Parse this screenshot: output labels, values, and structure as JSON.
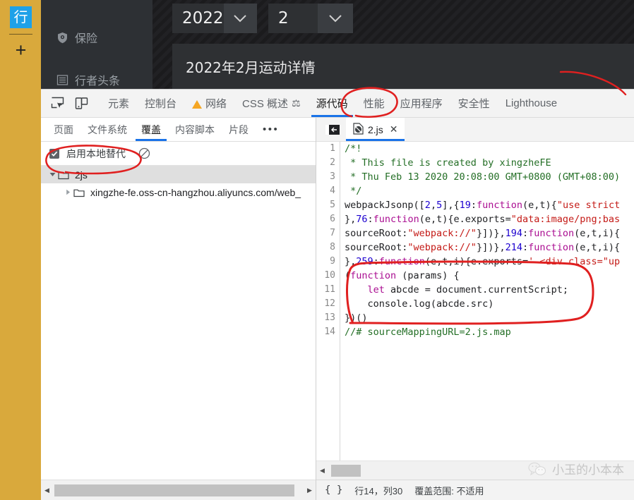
{
  "page": {
    "rail": {
      "logo_text": "行",
      "add_label": "+"
    },
    "sidebar": {
      "items": [
        {
          "label": "保险",
          "icon": "shield-icon"
        },
        {
          "label": "行者头条",
          "icon": "list-icon"
        }
      ]
    },
    "filters": {
      "year_value": "2022",
      "month_value": "2"
    },
    "content_title": "2022年2月运动详情"
  },
  "devtools": {
    "toolbar": {
      "inspect_icon": "inspect-element-icon",
      "device_icon": "device-toolbar-icon",
      "tabs": [
        {
          "label": "元素",
          "active": false,
          "warn": false
        },
        {
          "label": "控制台",
          "active": false,
          "warn": false
        },
        {
          "label": "网络",
          "active": false,
          "warn": true
        },
        {
          "label": "CSS 概述",
          "active": false,
          "warn": false,
          "flask": true
        },
        {
          "label": "源代码",
          "active": true,
          "warn": false
        },
        {
          "label": "性能",
          "active": false,
          "warn": false
        },
        {
          "label": "应用程序",
          "active": false,
          "warn": false
        },
        {
          "label": "安全性",
          "active": false,
          "warn": false
        },
        {
          "label": "Lighthouse",
          "active": false,
          "warn": false
        }
      ]
    },
    "navigator": {
      "tabs": [
        {
          "label": "页面",
          "active": false
        },
        {
          "label": "文件系统",
          "active": false
        },
        {
          "label": "覆盖",
          "active": true
        },
        {
          "label": "内容脚本",
          "active": false
        },
        {
          "label": "片段",
          "active": false
        }
      ],
      "more_label": "•••",
      "enable_overrides_label": "启用本地替代",
      "enable_overrides_checked": true,
      "clear_icon": "clear-overrides-icon",
      "tree": [
        {
          "label": "2js",
          "depth": 0,
          "expanded": true,
          "selected": true
        },
        {
          "label": "xingzhe-fe.oss-cn-hangzhou.aliyuncs.com/web_",
          "depth": 1,
          "expanded": false,
          "selected": false
        }
      ]
    },
    "sources": {
      "back_icon": "show-navigator-icon",
      "file_tab": {
        "label": "2.js",
        "icon": "js-override-file-icon",
        "close_icon": "close-icon"
      },
      "lines": [
        {
          "n": 1,
          "segments": [
            {
              "t": "/*!",
              "c": "cm"
            }
          ]
        },
        {
          "n": 2,
          "segments": [
            {
              "t": " * This file is created by xingzheFE",
              "c": "cm"
            }
          ]
        },
        {
          "n": 3,
          "segments": [
            {
              "t": " * Thu Feb 13 2020 20:08:00 GMT+0800 (GMT+08:00)",
              "c": "cm"
            }
          ]
        },
        {
          "n": 4,
          "segments": [
            {
              "t": " */",
              "c": "cm"
            }
          ]
        },
        {
          "n": 5,
          "segments": [
            {
              "t": "webpackJsonp([",
              "c": ""
            },
            {
              "t": "2",
              "c": "num"
            },
            {
              "t": ",",
              "c": ""
            },
            {
              "t": "5",
              "c": "num"
            },
            {
              "t": "],{",
              "c": ""
            },
            {
              "t": "19",
              "c": "num"
            },
            {
              "t": ":",
              "c": ""
            },
            {
              "t": "function",
              "c": "kw"
            },
            {
              "t": "(e,t){",
              "c": ""
            },
            {
              "t": "\"use strict",
              "c": "str"
            }
          ]
        },
        {
          "n": 6,
          "segments": [
            {
              "t": "},",
              "c": ""
            },
            {
              "t": "76",
              "c": "num"
            },
            {
              "t": ":",
              "c": ""
            },
            {
              "t": "function",
              "c": "kw"
            },
            {
              "t": "(e,t){e.exports=",
              "c": ""
            },
            {
              "t": "\"data:image/png;bas",
              "c": "str"
            }
          ]
        },
        {
          "n": 7,
          "segments": [
            {
              "t": "sourceRoot:",
              "c": ""
            },
            {
              "t": "\"webpack://\"",
              "c": "str"
            },
            {
              "t": "}])},",
              "c": ""
            },
            {
              "t": "194",
              "c": "num"
            },
            {
              "t": ":",
              "c": ""
            },
            {
              "t": "function",
              "c": "kw"
            },
            {
              "t": "(e,t,i){",
              "c": ""
            }
          ]
        },
        {
          "n": 8,
          "segments": [
            {
              "t": "sourceRoot:",
              "c": ""
            },
            {
              "t": "\"webpack://\"",
              "c": "str"
            },
            {
              "t": "}])},",
              "c": ""
            },
            {
              "t": "214",
              "c": "num"
            },
            {
              "t": ":",
              "c": ""
            },
            {
              "t": "function",
              "c": "kw"
            },
            {
              "t": "(e,t,i){",
              "c": ""
            }
          ]
        },
        {
          "n": 9,
          "segments": [
            {
              "t": "},",
              "c": ""
            },
            {
              "t": "259",
              "c": "num"
            },
            {
              "t": ":",
              "c": ""
            },
            {
              "t": "function",
              "c": "kw"
            },
            {
              "t": "(e,t,i){e.exports=",
              "c": ""
            },
            {
              "t": "' <div class=\"up",
              "c": "str"
            }
          ]
        },
        {
          "n": 10,
          "segments": [
            {
              "t": "(",
              "c": ""
            },
            {
              "t": "function",
              "c": "kw"
            },
            {
              "t": " (params) {",
              "c": ""
            }
          ]
        },
        {
          "n": 11,
          "segments": [
            {
              "t": "    ",
              "c": ""
            },
            {
              "t": "let",
              "c": "kw"
            },
            {
              "t": " abcde = document.currentScript;",
              "c": ""
            }
          ]
        },
        {
          "n": 12,
          "segments": [
            {
              "t": "    console.log(abcde.src)",
              "c": ""
            }
          ]
        },
        {
          "n": 13,
          "segments": [
            {
              "t": "})()",
              "c": ""
            }
          ]
        },
        {
          "n": 14,
          "segments": [
            {
              "t": "//# sourceMappingURL=2.js.map",
              "c": "cm"
            }
          ]
        }
      ]
    },
    "statusbar": {
      "format_icon": "{ }",
      "cursor_position": "行14，列30",
      "coverage": "覆盖范围: 不适用"
    }
  },
  "watermark": {
    "text": "小玉的小本本",
    "icon": "wechat-icon"
  },
  "annotations": {
    "sources_tab_circle": "red-ellipse-around-source-tab",
    "overrides_circle": "red-ellipse-around-enable-overrides",
    "code_circle": "red-rounded-rect-around-injected-code",
    "color": "#e02020"
  }
}
